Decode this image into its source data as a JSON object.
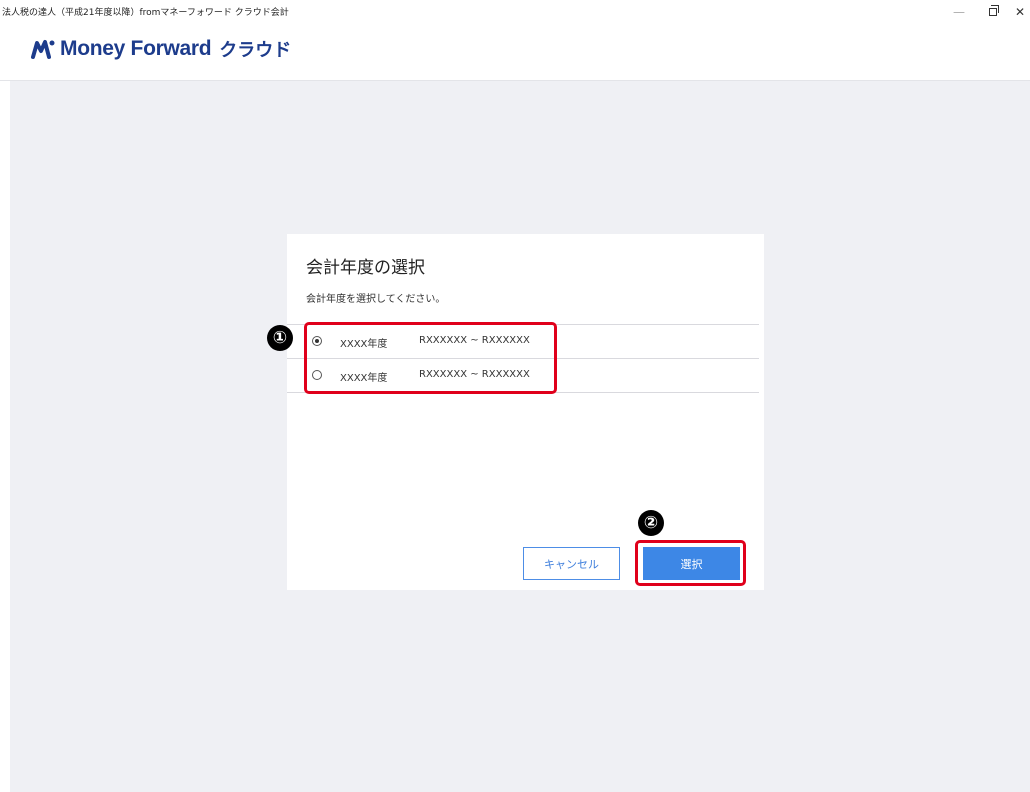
{
  "window": {
    "title": "法人税の達人（平成21年度以降）fromマネーフォワード クラウド会計",
    "minimize_glyph": "—",
    "close_glyph": "✕"
  },
  "header": {
    "logo_text": "Money Forward",
    "logo_suffix": "クラウド",
    "logo_icon": "money-forward-logo-icon"
  },
  "dialog": {
    "title": "会計年度の選択",
    "description": "会計年度を選択してください。",
    "options": [
      {
        "year": "XXXX年度",
        "range": "RXXXXXX ~ RXXXXXX",
        "selected": true
      },
      {
        "year": "XXXX年度",
        "range": "RXXXXXX ~ RXXXXXX",
        "selected": false
      }
    ],
    "cancel_label": "キャンセル",
    "select_label": "選択"
  },
  "annotations": {
    "marker_1": "①",
    "marker_2": "②",
    "color": "#e0001b"
  },
  "colors": {
    "brand": "#1d3c8c",
    "primary_button": "#3d87e6",
    "background": "#eff0f4"
  }
}
